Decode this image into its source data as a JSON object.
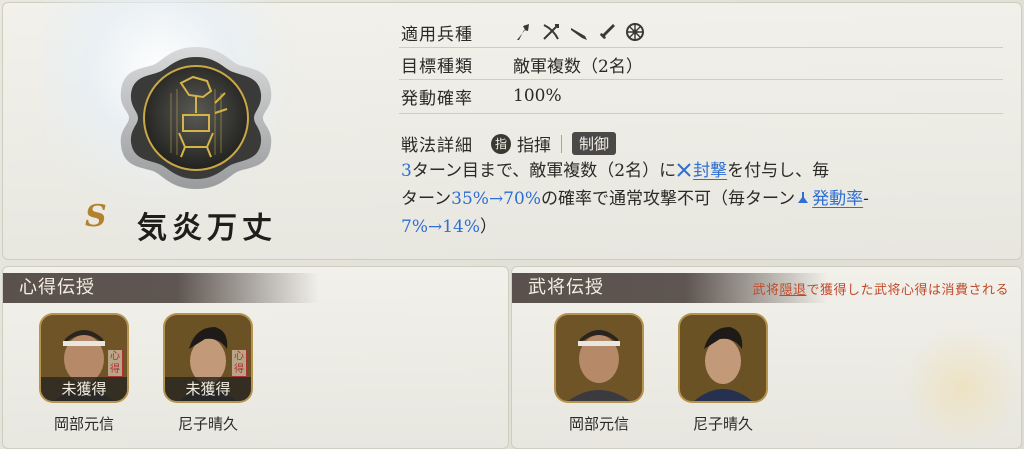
{
  "skill": {
    "rank": "S",
    "name": "気炎万丈",
    "applicable_units_label": "適用兵種",
    "unit_icons": [
      "spear-icon",
      "bow-icon",
      "rifle-icon",
      "sword-icon",
      "wheel-icon"
    ],
    "target_label": "目標種類",
    "target_value": "敵軍複数（2名）",
    "trigger_label": "発動確率",
    "trigger_value": "100%",
    "detail_label": "戦法詳細",
    "command_badge": "指",
    "command_label": "指揮",
    "control_badge": "制御"
  },
  "description": {
    "turns": "3",
    "part1": "ターン目まで、敵軍複数（2名）に",
    "seal_effect": "封撃",
    "part2": "を付与し、毎",
    "part3": "ターン",
    "chance_change": "35%→70%",
    "part4": "の確率で通常攻撃不可（毎ターン",
    "rate_effect": "発動率",
    "part5": "-",
    "rate_change": "7%→14%",
    "part6": "）"
  },
  "heart_transfer": {
    "title": "心得伝授",
    "generals": [
      {
        "name": "岡部元信",
        "status": "未獲得",
        "seal": "心得"
      },
      {
        "name": "尼子晴久",
        "status": "未獲得",
        "seal": "心得"
      }
    ]
  },
  "general_transfer": {
    "title": "武将伝授",
    "notice_pre": "武将",
    "notice_link": "隠退",
    "notice_post": "で獲得した武将心得は消費される",
    "generals": [
      {
        "name": "岡部元信"
      },
      {
        "name": "尼子晴久"
      }
    ]
  },
  "colors": {
    "accent_blue": "#2f6fd4",
    "header_bg": "#5a514c",
    "notice_red": "#c14a2a",
    "rank_gold": "#b3822d"
  }
}
